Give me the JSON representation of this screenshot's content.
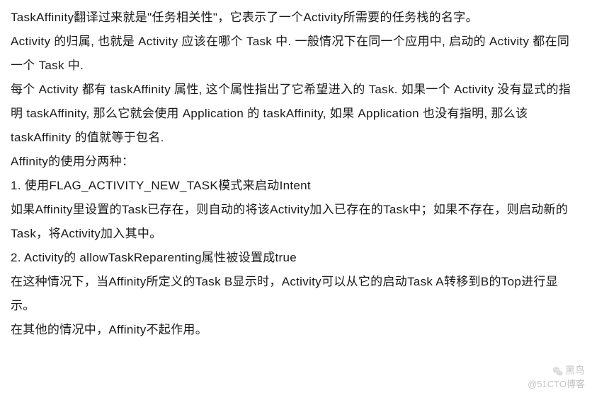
{
  "paragraphs": {
    "p1": "TaskAffinity翻译过来就是\"任务相关性\"，它表示了一个Activity所需要的任务栈的名字。",
    "p2": "Activity 的归属, 也就是 Activity 应该在哪个 Task 中. 一般情况下在同一个应用中, 启动的 Activity 都在同一个 Task 中.",
    "p3": "每个 Activity 都有 taskAffinity 属性, 这个属性指出了它希望进入的 Task. 如果一个 Activity 没有显式的指明 taskAffinity, 那么它就会使用 Application 的 taskAffinity, 如果 Application 也没有指明, 那么该 taskAffinity 的值就等于包名.",
    "p4": "Affinity的使用分两种：",
    "p5": "1. 使用FLAG_ACTIVITY_NEW_TASK模式来启动Intent",
    "p6": "如果Affinity里设置的Task已存在，则自动的将该Activity加入已存在的Task中；如果不存在，则启动新的Task，将Activity加入其中。",
    "p7": "2. Activity的 allowTaskReparenting属性被设置成true",
    "p8": "在这种情况下，当Affinity所定义的Task B显示时，Activity可以从它的启动Task A转移到B的Top进行显示。",
    "p9": "在其他的情况中，Affinity不起作用。"
  },
  "watermark": {
    "name": "黑鸟",
    "handle": "@51CTO博客"
  }
}
